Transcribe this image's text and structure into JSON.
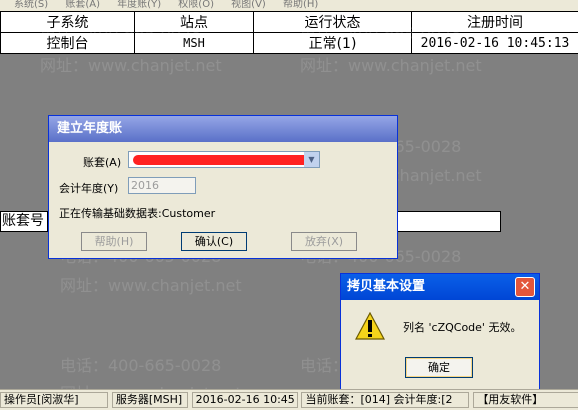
{
  "menu": [
    "系统(S)",
    "账套(A)",
    "年度账(Y)",
    "权限(O)",
    "视图(V)",
    "帮助(H)"
  ],
  "subsystem_table": {
    "headers": [
      "子系统",
      "站点",
      "运行状态",
      "注册时间"
    ],
    "rows": [
      [
        "控制台",
        "MSH",
        "正常(1)",
        "2016-02-16 10:45:13"
      ]
    ]
  },
  "watermark": {
    "phone": "电话：400-665-0028",
    "site": "网址：www.chanjet.net"
  },
  "account_panel": {
    "label": "账套号"
  },
  "create_year_dialog": {
    "title": "建立年度账",
    "account_label": "账套(A)",
    "account_value": "",
    "year_label": "会计年度(Y)",
    "year_value": "2016",
    "status_text": "正在传输基础数据表:Customer",
    "help_button": "帮助(H)",
    "ok_button": "确认(C)",
    "cancel_button": "放弃(X)"
  },
  "copy_settings_dialog": {
    "title": "拷贝基本设置",
    "message": "列名 'cZQCode' 无效。",
    "ok_button": "确定",
    "icon": "warning-icon"
  },
  "statusbar": {
    "operator": "操作员[闵淑华]",
    "server": "服务器[MSH]",
    "datetime": "2016-02-16 10:45",
    "current_account": "当前账套：[014] 会计年度:[2",
    "brand": "【用友软件】"
  },
  "colors": {
    "desktop": "#808080",
    "dialog_face": "#ece9d8",
    "title_inactive": "#7a8fd8",
    "title_active": "#0050e0",
    "redaction": "#ff2222",
    "close_button": "#e3563b"
  }
}
